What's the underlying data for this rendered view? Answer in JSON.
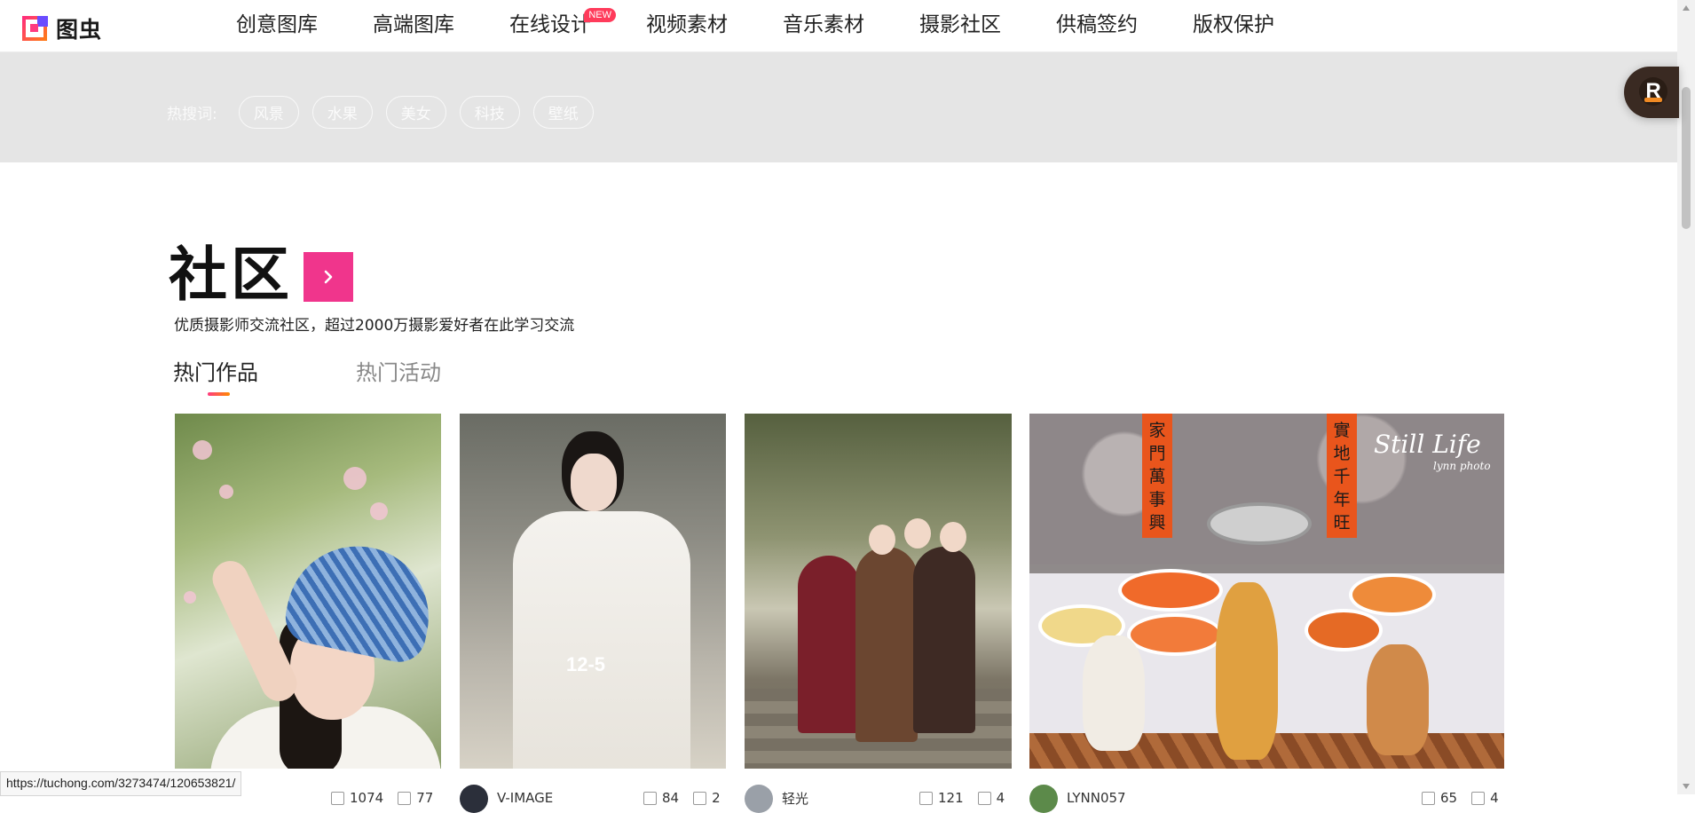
{
  "brand": {
    "name": "图虫"
  },
  "nav": {
    "items": [
      {
        "label": "创意图库"
      },
      {
        "label": "高端图库"
      },
      {
        "label": "在线设计",
        "badge": "NEW"
      },
      {
        "label": "视频素材"
      },
      {
        "label": "音乐素材"
      },
      {
        "label": "摄影社区"
      },
      {
        "label": "供稿签约"
      },
      {
        "label": "版权保护"
      }
    ]
  },
  "hot_search": {
    "label": "热搜词:",
    "terms": [
      "风景",
      "水果",
      "美女",
      "科技",
      "壁纸"
    ]
  },
  "community": {
    "title": "社区",
    "subtitle": "优质摄影师交流社区，超过2000万摄影爱好者在此学习交流",
    "tabs": [
      {
        "label": "热门作品",
        "active": true
      },
      {
        "label": "热门活动",
        "active": false
      }
    ]
  },
  "cards": [
    {
      "author": "",
      "likes": "1074",
      "comments": "77"
    },
    {
      "author": "V-IMAGE",
      "likes": "84",
      "comments": "2",
      "watermark": "12-5"
    },
    {
      "author": "轻光",
      "likes": "121",
      "comments": "4"
    },
    {
      "author": "LYNN057",
      "likes": "65",
      "comments": "4",
      "banner_left": "家門萬事興",
      "banner_right": "實地千年旺",
      "sign": "Still Life",
      "sign_sub": "lynn photo"
    }
  ],
  "status_url": "https://tuchong.com/3273474/120653821/",
  "colors": {
    "accent": "#f0358c",
    "badge": "#ff3b5b",
    "band": "#e5e5e5"
  }
}
